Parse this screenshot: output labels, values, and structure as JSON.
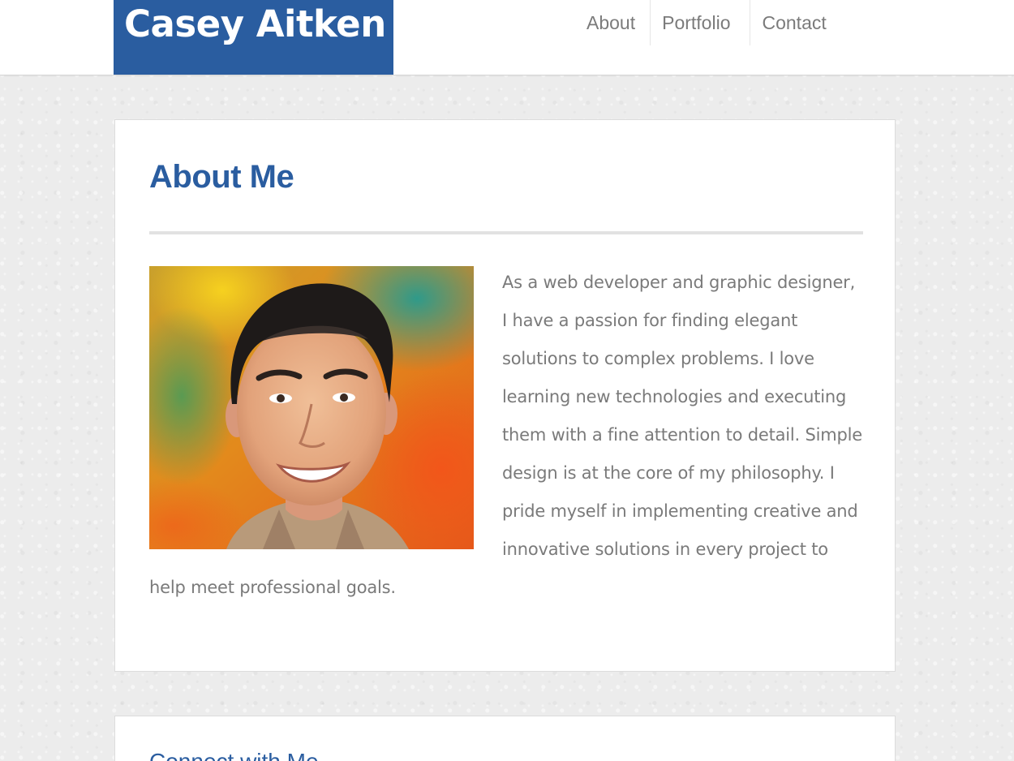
{
  "header": {
    "logo_text": "Casey Aitken",
    "nav": [
      {
        "label": "About"
      },
      {
        "label": "Portfolio"
      },
      {
        "label": "Contact"
      }
    ]
  },
  "about": {
    "title": "About Me",
    "text": "As a web developer and graphic designer, I have a passion for finding elegant solutions to complex problems. I love learning new technologies and executing them with a fine attention to detail. Simple design is at the core of my philosophy. I pride myself in implementing creative and innovative solutions in every project to help meet professional goals."
  },
  "connect": {
    "title": "Connect with Me"
  },
  "colors": {
    "brand": "#2a5da0",
    "nav_text": "#7b7b7b",
    "body_text": "#7a7a7a",
    "background": "#ececec"
  }
}
